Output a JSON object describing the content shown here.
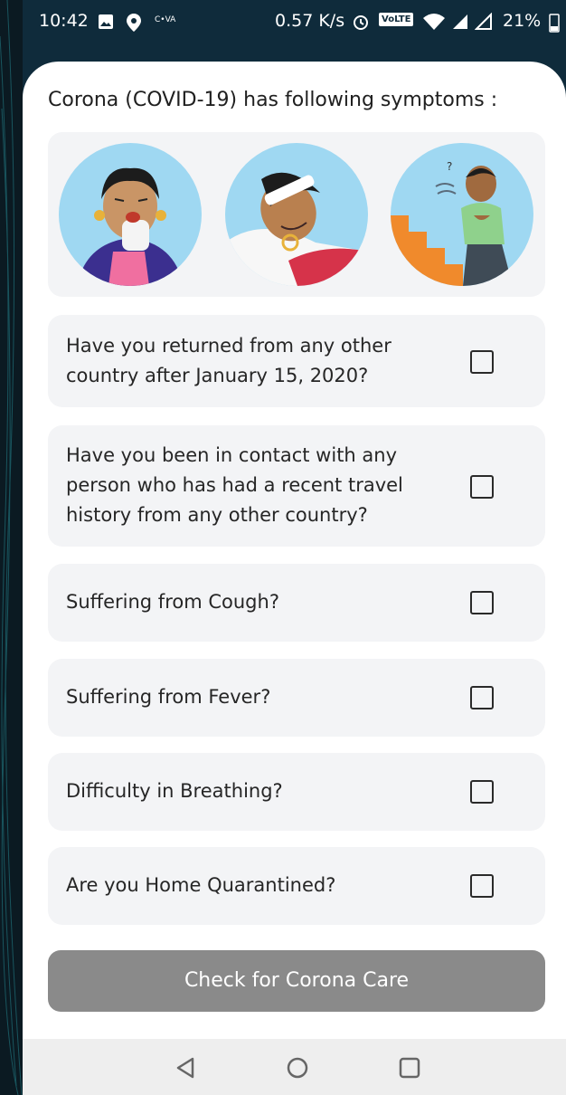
{
  "status_bar": {
    "time": "10:42",
    "carrier_tag": "C•VA",
    "speed": "0.57 K/s",
    "volte": "VoLTE",
    "battery": "21%"
  },
  "heading": "Corona (COVID-19) has following symptoms :",
  "illustrations": [
    {
      "icon": "coughing-woman-illustration"
    },
    {
      "icon": "fever-woman-in-bed-illustration"
    },
    {
      "icon": "breathless-man-on-stairs-illustration"
    }
  ],
  "questions": [
    {
      "label": "Have you returned from any other country after January 15, 2020?",
      "checked": false
    },
    {
      "label": "Have you been in contact with any person who has had a recent travel history from any other country?",
      "checked": false
    },
    {
      "label": "Suffering from Cough?",
      "checked": false
    },
    {
      "label": "Suffering from Fever?",
      "checked": false
    },
    {
      "label": "Difficulty in Breathing?",
      "checked": false
    },
    {
      "label": "Are you Home Quarantined?",
      "checked": false
    }
  ],
  "cta_label": "Check for Corona Care",
  "nav": [
    "back-icon",
    "home-icon",
    "recents-icon"
  ],
  "colors": {
    "background": "#0f2b3b",
    "card": "#f3f4f6",
    "cta": "#8a8a8a",
    "sky": "#9fd8f2"
  }
}
